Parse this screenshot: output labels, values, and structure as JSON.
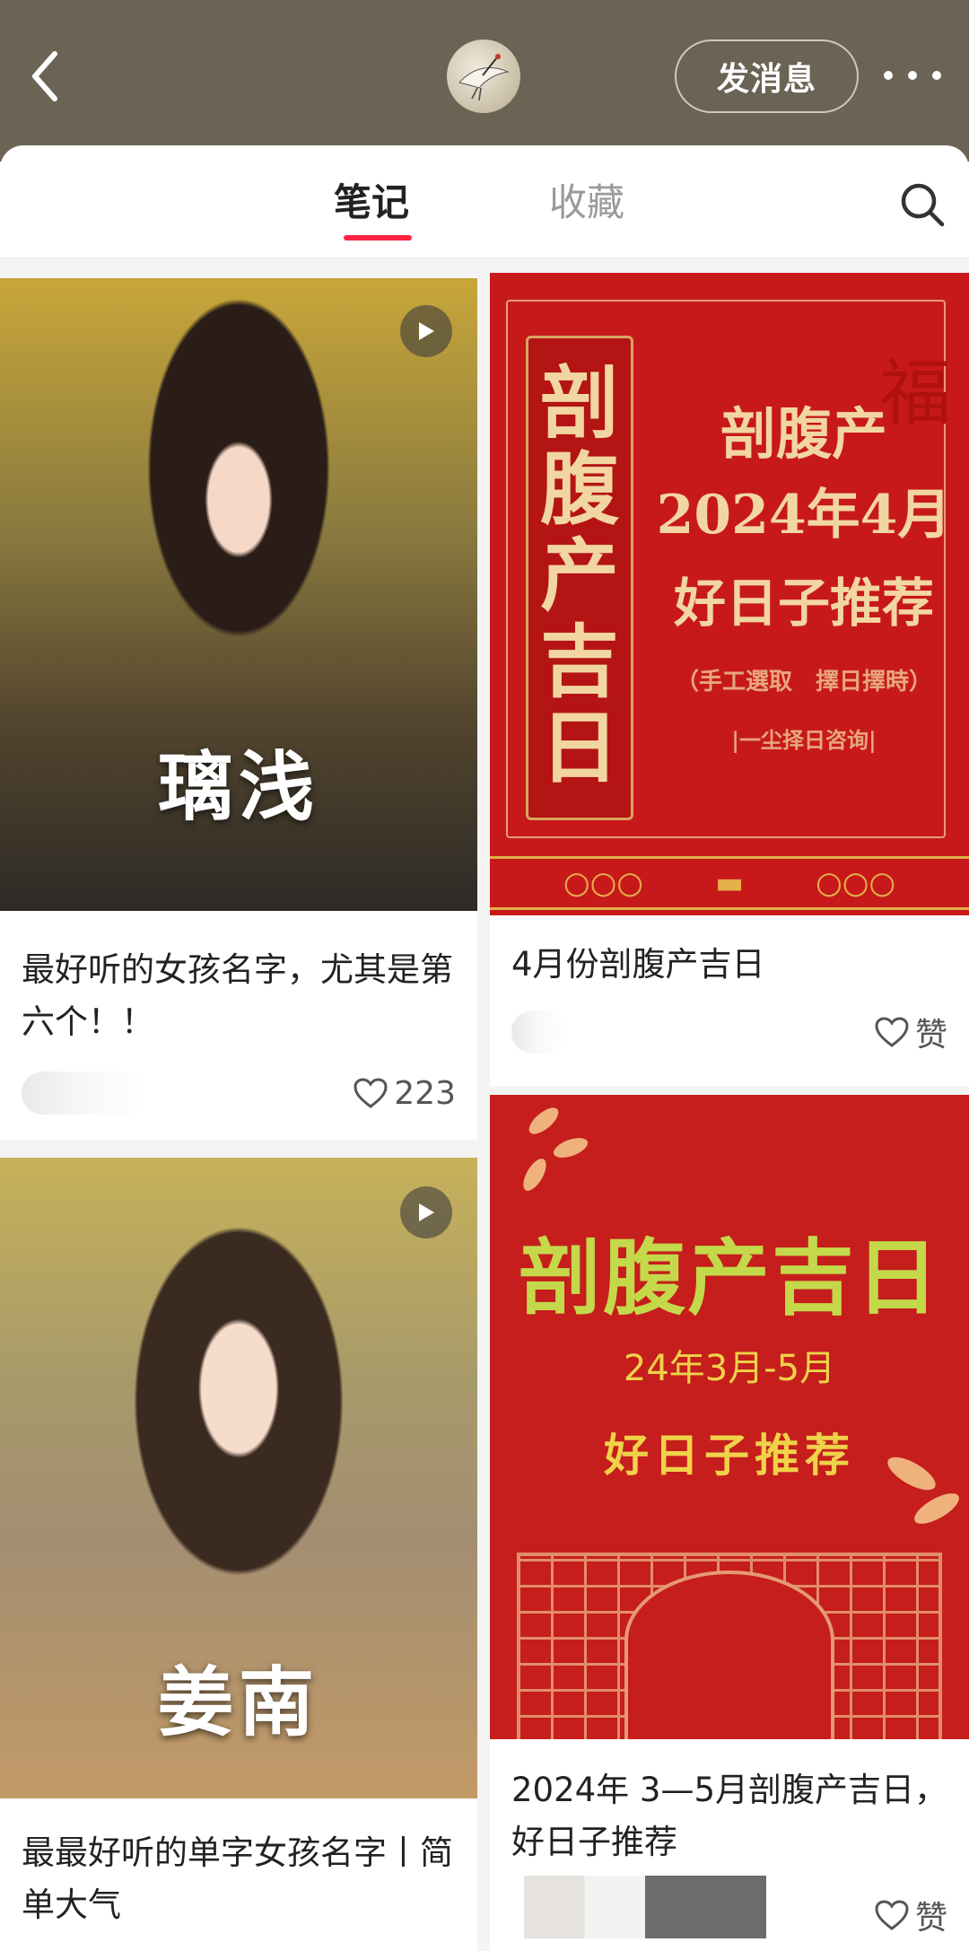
{
  "header": {
    "message_button": "发消息"
  },
  "tabs": {
    "notes": "笔记",
    "collections": "收藏"
  },
  "cards": [
    {
      "overlay_text": "璃浅",
      "title": "最好听的女孩名字，尤其是第六个！！",
      "likes": "223",
      "has_video": true
    },
    {
      "poster": {
        "vertical": "剖腹产吉日",
        "line1": "剖腹产",
        "line2": "2024年4月",
        "line3": "好日子推荐",
        "line4": "（手工選取　擇日擇時）",
        "line5": "|一尘择日咨询|",
        "fu": "福"
      },
      "title": "4月份剖腹产吉日",
      "likes": "赞"
    },
    {
      "overlay_text": "姜南",
      "title": "最最好听的单字女孩名字丨简单大气",
      "has_video": true
    },
    {
      "poster": {
        "line1": "剖腹产吉日",
        "line2": "24年3月-5月",
        "line3": "好日子推荐"
      },
      "title": "2024年 3—5月剖腹产吉日，好日子推荐",
      "likes": "赞"
    }
  ],
  "icons": {
    "back": "chevron-left-icon",
    "more": "more-dots-icon",
    "search": "search-icon",
    "like": "heart-outline-icon",
    "play": "play-icon"
  },
  "colors": {
    "header_bg": "#6b6354",
    "accent": "#ff2442",
    "poster_red": "#c8191a",
    "poster_gold": "#f2d6a2"
  }
}
